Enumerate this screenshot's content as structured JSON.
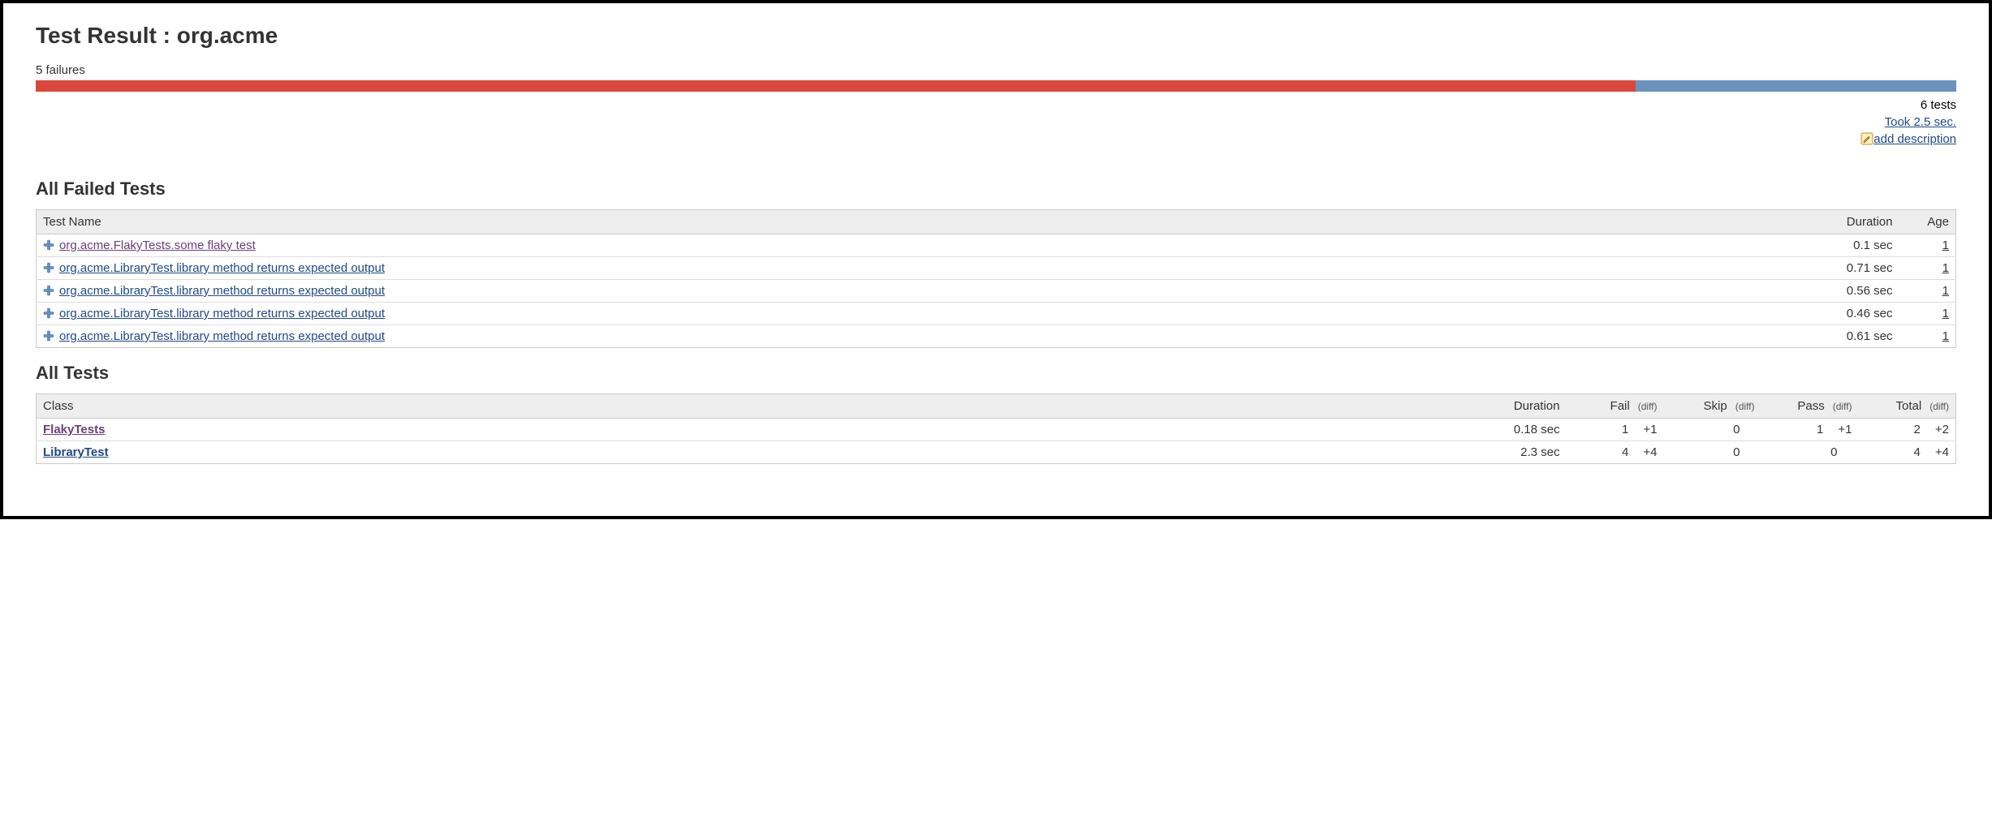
{
  "page": {
    "title": "Test Result : org.acme",
    "failures_label": "5 failures",
    "bar_fail_pct": 83.3,
    "bar_pass_pct": 16.7,
    "total_tests_label": "6 tests",
    "duration_label": "Took 2.5 sec.",
    "add_description_label": "add description"
  },
  "failed": {
    "heading": "All Failed Tests",
    "columns": {
      "name": "Test Name",
      "duration": "Duration",
      "age": "Age"
    },
    "rows": [
      {
        "name": "org.acme.FlakyTests.some flaky test",
        "visited": true,
        "duration": "0.1 sec",
        "age": "1"
      },
      {
        "name": "org.acme.LibraryTest.library method returns expected output",
        "visited": false,
        "duration": "0.71 sec",
        "age": "1"
      },
      {
        "name": "org.acme.LibraryTest.library method returns expected output",
        "visited": false,
        "duration": "0.56 sec",
        "age": "1"
      },
      {
        "name": "org.acme.LibraryTest.library method returns expected output",
        "visited": false,
        "duration": "0.46 sec",
        "age": "1"
      },
      {
        "name": "org.acme.LibraryTest.library method returns expected output",
        "visited": false,
        "duration": "0.61 sec",
        "age": "1"
      }
    ]
  },
  "all": {
    "heading": "All Tests",
    "columns": {
      "class": "Class",
      "duration": "Duration",
      "fail": "Fail",
      "skip": "Skip",
      "pass": "Pass",
      "total": "Total",
      "diff": "(diff)"
    },
    "rows": [
      {
        "class": "FlakyTests",
        "visited": true,
        "duration": "0.18 sec",
        "fail": "1",
        "fail_diff": "+1",
        "skip": "0",
        "skip_diff": "",
        "pass": "1",
        "pass_diff": "+1",
        "total": "2",
        "total_diff": "+2"
      },
      {
        "class": "LibraryTest",
        "visited": false,
        "duration": "2.3 sec",
        "fail": "4",
        "fail_diff": "+4",
        "skip": "0",
        "skip_diff": "",
        "pass": "0",
        "pass_diff": "",
        "total": "4",
        "total_diff": "+4"
      }
    ]
  }
}
